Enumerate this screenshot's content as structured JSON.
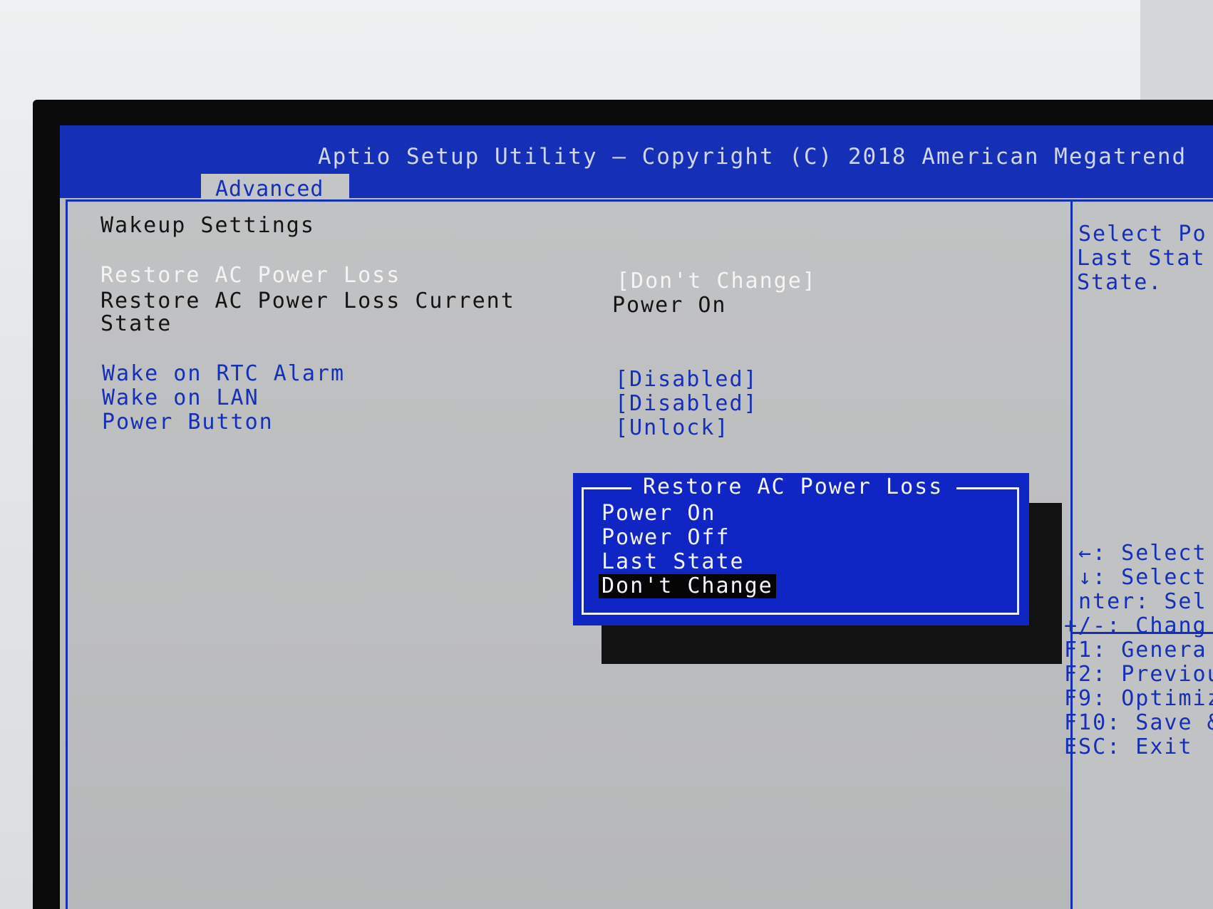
{
  "header": {
    "title": "Aptio Setup Utility – Copyright (C) 2018 American Megatrend",
    "tab_active": "Advanced"
  },
  "main": {
    "section_title": "Wakeup Settings",
    "items": [
      {
        "label": "Restore AC Power Loss",
        "value": "[Don't Change]"
      },
      {
        "label": "Restore AC Power Loss Current",
        "label2": "State",
        "value": "Power On"
      },
      {
        "label": "Wake on RTC Alarm",
        "value": "[Disabled]"
      },
      {
        "label": "Wake on LAN",
        "value": "[Disabled]"
      },
      {
        "label": "Power Button",
        "value": "[Unlock]"
      }
    ]
  },
  "popup": {
    "title": "Restore AC Power Loss",
    "options": [
      "Power On",
      "Power Off",
      "Last State",
      "Don't Change"
    ],
    "selected_index": 3
  },
  "help": {
    "description_lines": [
      "Select Po",
      "Last Stat",
      "State."
    ],
    "keys": [
      "←: Select",
      "↓: Select",
      "nter: Sel",
      "+/-: Chang",
      "F1: Genera",
      "F2: Previou",
      "F9: Optimiz",
      "F10: Save &",
      "ESC: Exit"
    ]
  },
  "colors": {
    "accent_blue": "#1530b6",
    "popup_blue": "#0f25c4",
    "background_gray": "#b9babb"
  }
}
